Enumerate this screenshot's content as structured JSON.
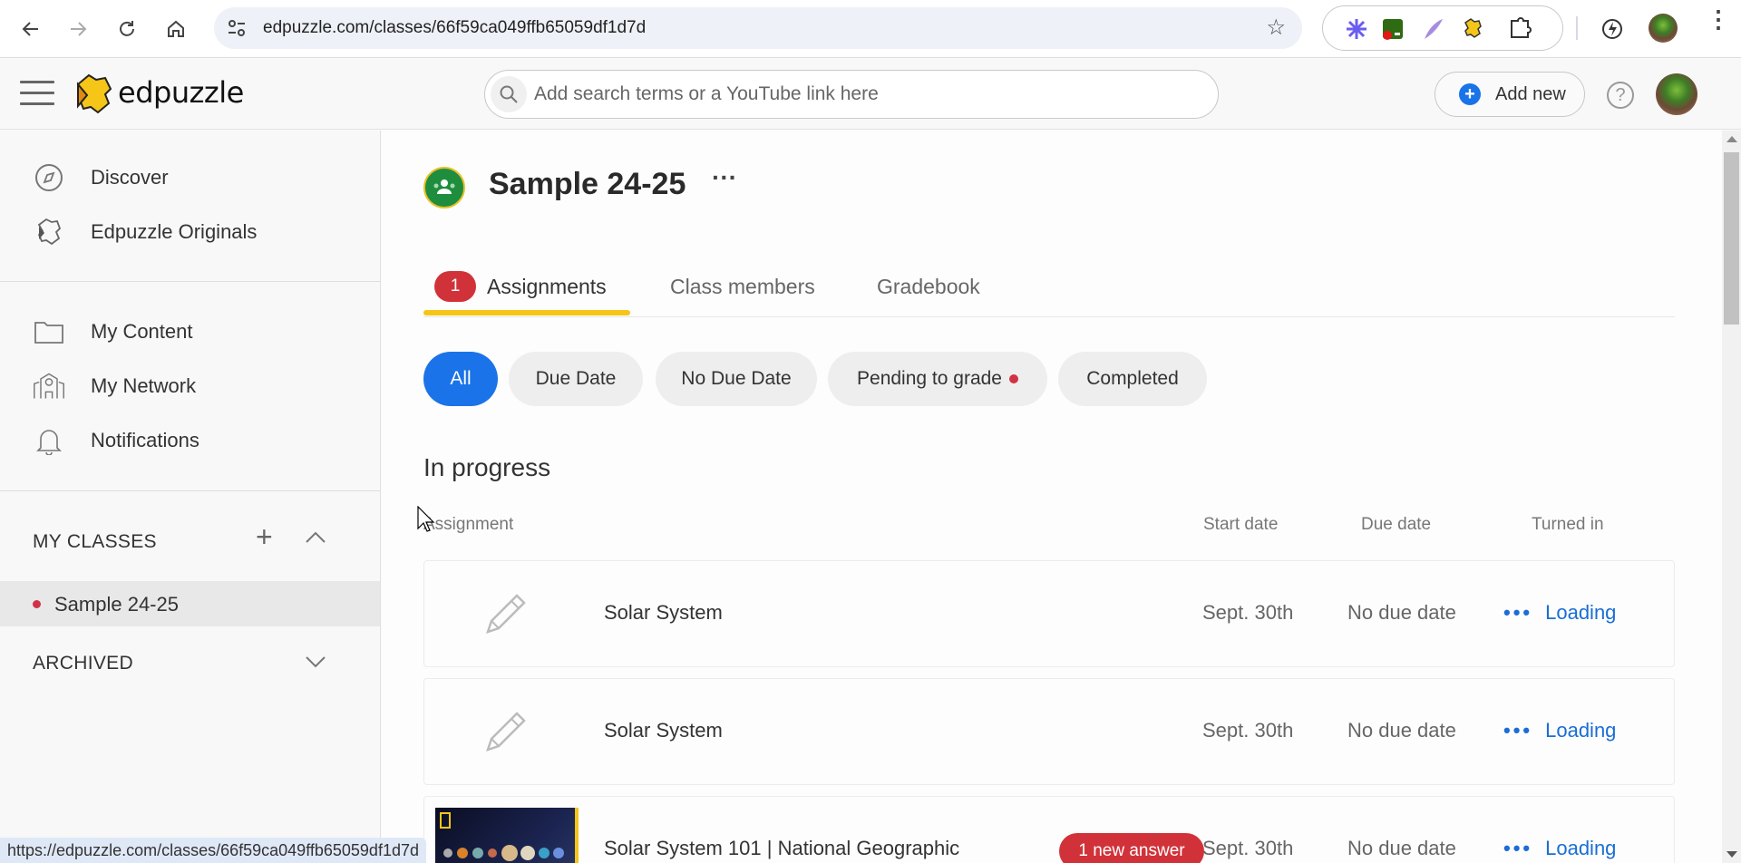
{
  "browser": {
    "url": "edpuzzle.com/classes/66f59ca049ffb65059df1d7d",
    "status_url": "https://edpuzzle.com/classes/66f59ca049ffb65059df1d7d",
    "back_icon": "arrow-left",
    "forward_icon": "arrow-right",
    "reload_icon": "reload",
    "home_icon": "home",
    "extensions": [
      "asterisk-extension",
      "screen-recorder-extension",
      "quill-extension",
      "edpuzzle-extension",
      "puzzle-extensions-menu"
    ]
  },
  "app": {
    "brand": "edpuzzle",
    "search_placeholder": "Add search terms or a YouTube link here",
    "add_new_label": "Add new",
    "help_label": "?"
  },
  "sidebar": {
    "top_items": [
      {
        "label": "Discover",
        "icon": "compass"
      },
      {
        "label": "Edpuzzle Originals",
        "icon": "edpuzzle-puzzle"
      }
    ],
    "mid_items": [
      {
        "label": "My Content",
        "icon": "folder"
      },
      {
        "label": "My Network",
        "icon": "school-building"
      },
      {
        "label": "Notifications",
        "icon": "bell"
      }
    ],
    "my_classes_label": "MY CLASSES",
    "classes": [
      {
        "label": "Sample 24-25",
        "has_notification": true,
        "selected": true
      }
    ],
    "archived_label": "ARCHIVED"
  },
  "main": {
    "class_title": "Sample 24-25",
    "more_label": "···",
    "tabs": [
      {
        "label": "Assignments",
        "count": "1",
        "active": true
      },
      {
        "label": "Class members",
        "active": false
      },
      {
        "label": "Gradebook",
        "active": false
      }
    ],
    "filters": [
      {
        "label": "All",
        "active": true
      },
      {
        "label": "Due Date",
        "active": false
      },
      {
        "label": "No Due Date",
        "active": false
      },
      {
        "label": "Pending to grade",
        "active": false,
        "has_dot": true
      },
      {
        "label": "Completed",
        "active": false
      }
    ],
    "section_title": "In progress",
    "columns": {
      "assignment": "Assignment",
      "start_date": "Start date",
      "due_date": "Due date",
      "turned_in": "Turned in"
    },
    "rows": [
      {
        "title": "Solar System",
        "thumb": "pencil",
        "start": "Sept. 30th",
        "due": "No due date",
        "turned_in": "Loading",
        "badge": null
      },
      {
        "title": "Solar System",
        "thumb": "pencil",
        "start": "Sept. 30th",
        "due": "No due date",
        "turned_in": "Loading",
        "badge": null
      },
      {
        "title": "Solar System 101 | National Geographic",
        "thumb": "video-thumbnail",
        "start": "Sept. 30th",
        "due": "No due date",
        "turned_in": "Loading",
        "badge": "1 new answer"
      }
    ],
    "loading_dots": "•••"
  },
  "colors": {
    "accent_blue": "#1a73e8",
    "tab_underline": "#f5c518",
    "alert_red": "#d13239",
    "class_green": "#1e8e3e"
  }
}
